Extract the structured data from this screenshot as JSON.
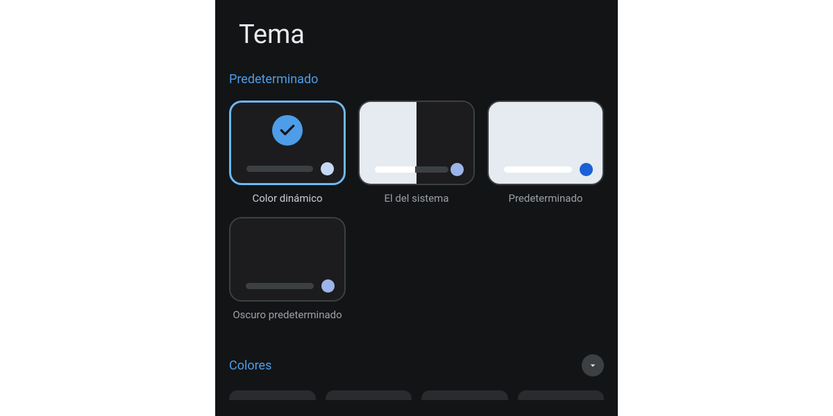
{
  "page_title": "Tema",
  "sections": {
    "predeterminado": {
      "header": "Predeterminado",
      "themes": [
        {
          "id": "dynamic",
          "label": "Color dinámico",
          "selected": true
        },
        {
          "id": "system",
          "label": "El del sistema",
          "selected": false
        },
        {
          "id": "light",
          "label": "Predeterminado",
          "selected": false
        },
        {
          "id": "dark",
          "label": "Oscuro predeterminado",
          "selected": false
        }
      ]
    },
    "colores": {
      "header": "Colores"
    }
  },
  "colors": {
    "accent": "#4d9de8",
    "background": "#131416",
    "card_border": "#3c4043"
  }
}
